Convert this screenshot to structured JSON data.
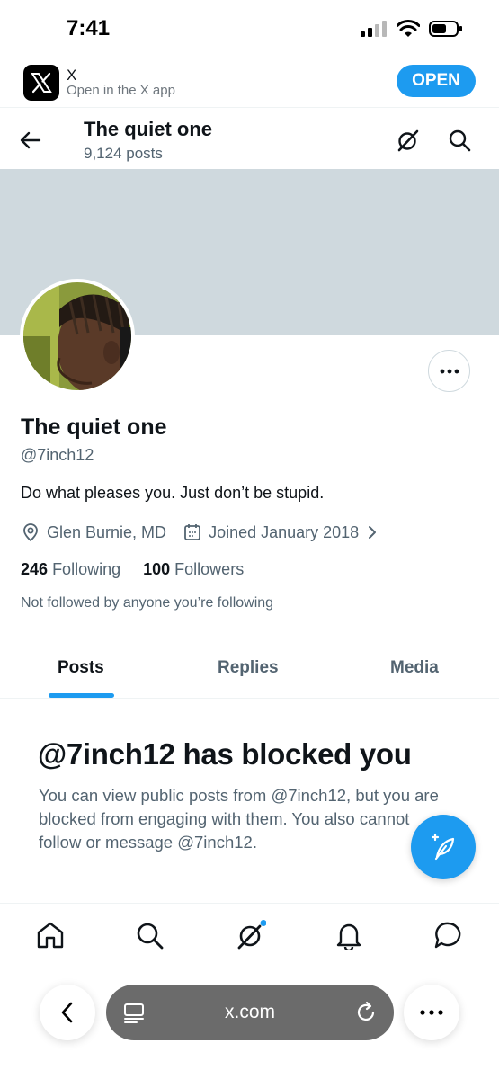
{
  "status_bar": {
    "time": "7:41"
  },
  "app_banner": {
    "app_name": "X",
    "subtitle": "Open in the X app",
    "open_label": "OPEN"
  },
  "header": {
    "title": "The quiet one",
    "post_count": "9,124 posts"
  },
  "profile": {
    "display_name": "The quiet one",
    "handle": "@7inch12",
    "bio": "Do what pleases you. Just don’t be stupid.",
    "location": "Glen Burnie, MD",
    "joined": "Joined January 2018",
    "following_count": "246",
    "following_label": "Following",
    "followers_count": "100",
    "followers_label": "Followers",
    "mutuals_note": "Not followed by anyone you’re following"
  },
  "tabs": [
    {
      "label": "Posts",
      "active": true
    },
    {
      "label": "Replies",
      "active": false
    },
    {
      "label": "Media",
      "active": false
    }
  ],
  "blocked": {
    "title": "@7inch12 has blocked you",
    "body": "You can view public posts from @7inch12, but you are blocked from engaging with them. You also cannot follow or message @7inch12."
  },
  "bottom_nav": {
    "items": [
      "home-icon",
      "search-icon",
      "grok-icon",
      "notifications-icon",
      "messages-icon"
    ]
  },
  "browser": {
    "url": "x.com"
  },
  "colors": {
    "accent": "#1d9bf0",
    "text_primary": "#0f1419",
    "text_secondary": "#536471",
    "banner": "#cfd9de"
  }
}
